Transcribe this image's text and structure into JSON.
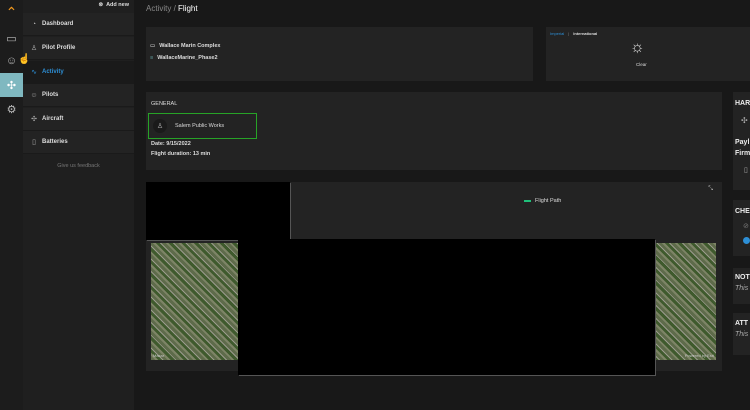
{
  "sidebar": {
    "add_new": "Add new",
    "items": [
      {
        "label": "Dashboard",
        "icon": "dashboard-icon"
      },
      {
        "label": "Pilot Profile",
        "icon": "user-icon"
      },
      {
        "label": "Activity",
        "icon": "activity-icon"
      },
      {
        "label": "Pilots",
        "icon": "users-icon"
      },
      {
        "label": "Aircraft",
        "icon": "drone-icon"
      },
      {
        "label": "Batteries",
        "icon": "battery-icon"
      }
    ],
    "feedback": "Give us feedback"
  },
  "breadcrumb": {
    "parent": "Activity",
    "sep": " / ",
    "current": "Flight"
  },
  "project": {
    "site": "Wallace Marin Complex",
    "phase": "WallaceMarine_Phase2"
  },
  "weather": {
    "unit_imperial": "Imperial",
    "unit_international": "International",
    "condition": "Clear"
  },
  "general": {
    "title": "GENERAL",
    "organization": "Salem Public Works",
    "date": "Date: 9/15/2022",
    "duration": "Flight duration: 13 min"
  },
  "map": {
    "legend": "Flight Path",
    "attribution_left": "Maxar",
    "attribution_right": "Powered by Esri"
  },
  "right": {
    "hardware": "HAR",
    "payload": "Payl",
    "firmware": "Firm",
    "checklist": "CHE",
    "notes": "NOT",
    "notes_text": "This",
    "attachments": "ATT",
    "attachments_text": "This"
  },
  "colors": {
    "accent": "#2d8fd6",
    "highlight": "#27a327",
    "legend": "#1fbf7a"
  }
}
